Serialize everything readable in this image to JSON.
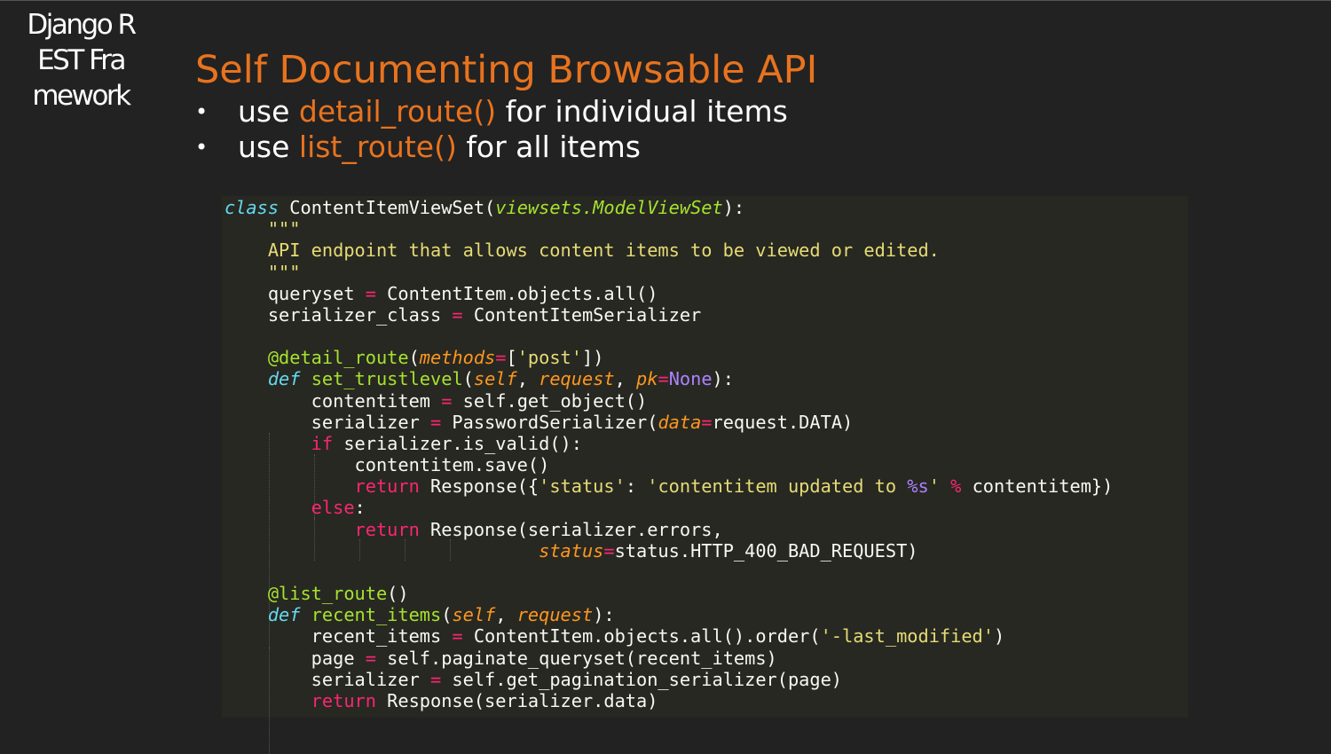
{
  "sidebar": {
    "title": "Django REST Framework"
  },
  "slide": {
    "title": "Self Documenting Browsable API",
    "bullets": [
      {
        "pre": "use ",
        "highlight": "detail_route()",
        "post": " for individual items"
      },
      {
        "pre": "use ",
        "highlight": "list_route()",
        "post": " for all items"
      }
    ]
  },
  "colors": {
    "accent": "#e8731e",
    "background": "#222222",
    "code_background": "#272822"
  },
  "code": {
    "lines": [
      [
        [
          "sto",
          "class"
        ],
        [
          "sw",
          " ContentItemViewSet("
        ],
        [
          "inh",
          "viewsets.ModelViewSet"
        ],
        [
          "sw",
          "):"
        ]
      ],
      [
        [
          "str",
          "    \"\"\""
        ]
      ],
      [
        [
          "str",
          "    API endpoint that allows content items to be viewed or edited."
        ]
      ],
      [
        [
          "str",
          "    \"\"\""
        ]
      ],
      [
        [
          "sw",
          "    queryset "
        ],
        [
          "op",
          "="
        ],
        [
          "sw",
          " ContentItem.objects.all()"
        ]
      ],
      [
        [
          "sw",
          "    serializer_class "
        ],
        [
          "op",
          "="
        ],
        [
          "sw",
          " ContentItemSerializer"
        ]
      ],
      [
        [
          "sw",
          ""
        ]
      ],
      [
        [
          "fn",
          "    @detail_route"
        ],
        [
          "sw",
          "("
        ],
        [
          "arg",
          "methods"
        ],
        [
          "op",
          "="
        ],
        [
          "sw",
          "["
        ],
        [
          "str",
          "'post'"
        ],
        [
          "sw",
          "])"
        ]
      ],
      [
        [
          "sto",
          "    def"
        ],
        [
          "sw",
          " "
        ],
        [
          "fn",
          "set_trustlevel"
        ],
        [
          "sw",
          "("
        ],
        [
          "arg",
          "self"
        ],
        [
          "sw",
          ", "
        ],
        [
          "arg",
          "request"
        ],
        [
          "sw",
          ", "
        ],
        [
          "arg",
          "pk"
        ],
        [
          "op",
          "="
        ],
        [
          "cst",
          "None"
        ],
        [
          "sw",
          "):"
        ]
      ],
      [
        [
          "sw",
          "        contentitem "
        ],
        [
          "op",
          "="
        ],
        [
          "sw",
          " self.get_object()"
        ]
      ],
      [
        [
          "sw",
          "        serializer "
        ],
        [
          "op",
          "="
        ],
        [
          "sw",
          " PasswordSerializer("
        ],
        [
          "arg",
          "data"
        ],
        [
          "op",
          "="
        ],
        [
          "sw",
          "request.DATA)"
        ]
      ],
      [
        [
          "kw",
          "        if"
        ],
        [
          "sw",
          " serializer.is_valid():"
        ]
      ],
      [
        [
          "sw",
          "            contentitem.save()"
        ]
      ],
      [
        [
          "kw",
          "            return"
        ],
        [
          "sw",
          " Response({"
        ],
        [
          "str",
          "'status'"
        ],
        [
          "sw",
          ": "
        ],
        [
          "str",
          "'contentitem updated to "
        ],
        [
          "cst",
          "%s"
        ],
        [
          "str",
          "'"
        ],
        [
          "sw",
          " "
        ],
        [
          "op",
          "%"
        ],
        [
          "sw",
          " contentitem})"
        ]
      ],
      [
        [
          "kw",
          "        else"
        ],
        [
          "sw",
          ":"
        ]
      ],
      [
        [
          "kw",
          "            return"
        ],
        [
          "sw",
          " Response(serializer.errors,"
        ]
      ],
      [
        [
          "sw",
          "                             "
        ],
        [
          "arg",
          "status"
        ],
        [
          "op",
          "="
        ],
        [
          "sw",
          "status.HTTP_400_BAD_REQUEST)"
        ]
      ],
      [
        [
          "sw",
          ""
        ]
      ],
      [
        [
          "fn",
          "    @list_route"
        ],
        [
          "sw",
          "()"
        ]
      ],
      [
        [
          "sto",
          "    def"
        ],
        [
          "sw",
          " "
        ],
        [
          "fn",
          "recent_items"
        ],
        [
          "sw",
          "("
        ],
        [
          "arg",
          "self"
        ],
        [
          "sw",
          ", "
        ],
        [
          "arg",
          "request"
        ],
        [
          "sw",
          "):"
        ]
      ],
      [
        [
          "sw",
          "        recent_items "
        ],
        [
          "op",
          "="
        ],
        [
          "sw",
          " ContentItem.objects.all().order("
        ],
        [
          "str",
          "'-last_modified'"
        ],
        [
          "sw",
          ")"
        ]
      ],
      [
        [
          "sw",
          "        page "
        ],
        [
          "op",
          "="
        ],
        [
          "sw",
          " self.paginate_queryset(recent_items)"
        ]
      ],
      [
        [
          "sw",
          "        serializer "
        ],
        [
          "op",
          "="
        ],
        [
          "sw",
          " self.get_pagination_serializer(page)"
        ]
      ],
      [
        [
          "kw",
          "        return"
        ],
        [
          "sw",
          " Response(serializer.data)"
        ]
      ]
    ]
  }
}
